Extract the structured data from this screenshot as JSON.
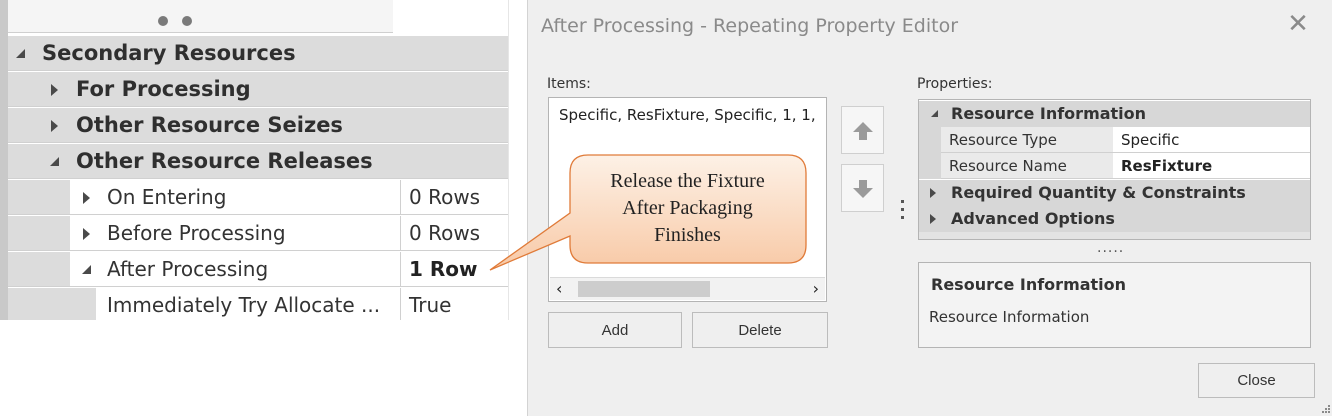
{
  "property_grid": {
    "rows": [
      {
        "label": "Secondary Resources",
        "value": ""
      },
      {
        "label": "For Processing",
        "value": ""
      },
      {
        "label": "Other Resource Seizes",
        "value": ""
      },
      {
        "label": "Other Resource Releases",
        "value": ""
      },
      {
        "label": "On Entering",
        "value": "0 Rows"
      },
      {
        "label": "Before Processing",
        "value": "0 Rows"
      },
      {
        "label": "After Processing",
        "value": "1 Row"
      },
      {
        "label": "Immediately Try Allocate ...",
        "value": "True"
      }
    ]
  },
  "dialog": {
    "title": "After Processing - Repeating Property Editor",
    "items_label": "Items:",
    "items": [
      "Specific, ResFixture, Specific, 1, 1,"
    ],
    "add_label": "Add",
    "delete_label": "Delete",
    "properties_label": "Properties:",
    "properties": {
      "categories": [
        {
          "label": "Resource Information",
          "expanded": true,
          "rows": [
            {
              "key": "Resource Type",
              "value": "Specific"
            },
            {
              "key": "Resource Name",
              "value": "ResFixture"
            }
          ]
        },
        {
          "label": "Required Quantity & Constraints",
          "expanded": false
        },
        {
          "label": "Advanced Options",
          "expanded": false
        }
      ]
    },
    "description": {
      "heading": "Resource Information",
      "body": "Resource Information"
    },
    "close_label": "Close"
  },
  "callout": {
    "lines": [
      "Release the Fixture",
      "After Packaging",
      "Finishes"
    ],
    "fill_top": "#fdf1e6",
    "fill_bottom": "#f8c9a6",
    "stroke": "#e07b39"
  }
}
